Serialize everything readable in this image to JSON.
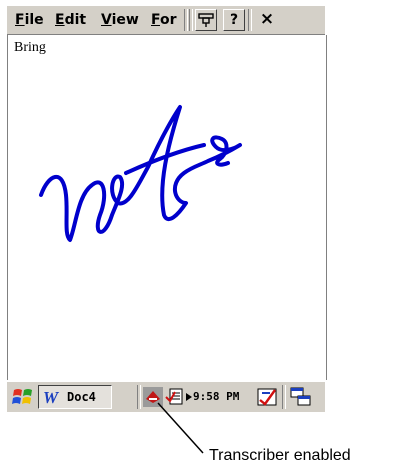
{
  "menu": {
    "items": [
      {
        "label": "File",
        "mnemonic": "F"
      },
      {
        "label": "Edit",
        "mnemonic": "E"
      },
      {
        "label": "View",
        "mnemonic": "V"
      },
      {
        "label": "For",
        "mnemonic": "F"
      }
    ],
    "help_label": "?",
    "close_label": "×"
  },
  "document": {
    "text": "Bring"
  },
  "taskbar": {
    "task_label": "Doc4",
    "clock": "9:58 PM"
  },
  "callout": {
    "text": "Transcriber enabled"
  },
  "colors": {
    "chrome": "#d4d0c8",
    "ink": "#0000cc"
  }
}
